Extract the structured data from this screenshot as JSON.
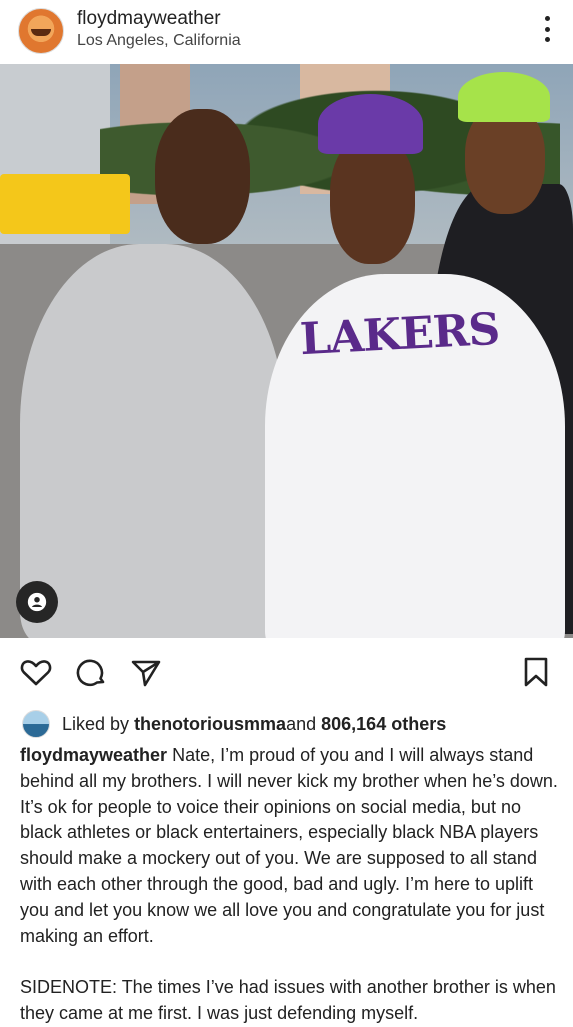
{
  "post": {
    "username": "floydmayweather",
    "location": "Los Angeles, California",
    "photo_jersey_text": "LAKERS"
  },
  "icons": {
    "more": "more-vertical-icon",
    "heart": "heart-icon",
    "comment": "comment-icon",
    "share": "send-icon",
    "save": "bookmark-icon",
    "tag": "user-tag-icon"
  },
  "likes": {
    "prefix": "Liked by ",
    "user": "thenotoriousmma",
    "middle": " and ",
    "count": "806,164 others"
  },
  "caption": {
    "user": "floydmayweather",
    "text": " Nate, I’m proud of you and I will always stand behind all my brothers.  I will never kick my brother when he’s down.  It’s ok for people to voice their opinions on social media, but no black athletes or black entertainers, especially black NBA players should make a mockery out of you.  We are supposed to all stand with each other through the good, bad and ugly. I’m here to uplift you and let you know we all love you and congratulate you for just making an effort.",
    "sidenote": "SIDENOTE:  The times I’ve had issues with another brother is when they came at me first. I was just defending myself."
  },
  "colors": {
    "text": "#262626",
    "background": "#ffffff",
    "lakers_purple": "#5a2a8a",
    "lakers_gold": "#f4c71a"
  }
}
